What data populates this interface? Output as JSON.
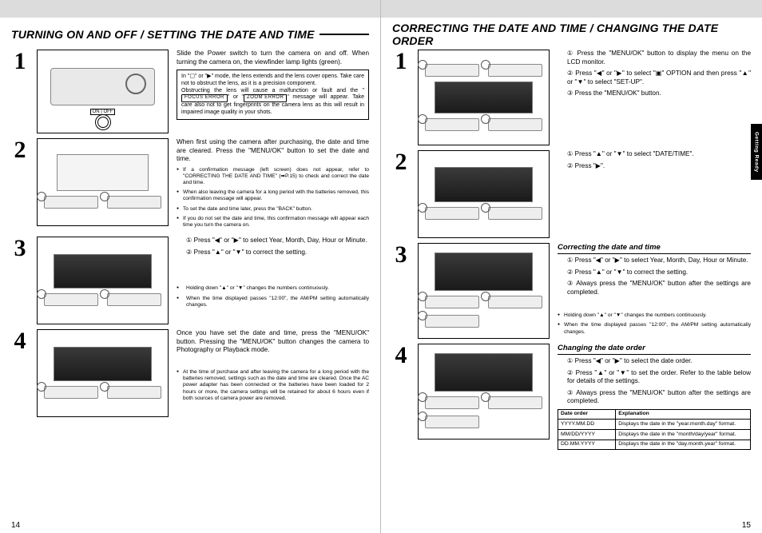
{
  "left": {
    "title": "TURNING ON AND OFF / SETTING THE DATE AND TIME",
    "page_num": "14",
    "steps": {
      "s1": {
        "num": "1",
        "body": "Slide the Power switch to turn the camera on and off. When turning the camera on, the viewfinder lamp lights (green).",
        "note": "In \"▢\" or \"▶\" mode, the lens extends and the lens cover opens. Take care not to obstruct the lens, as it is a precision component.\nObstructing the lens will cause a malfunction or fault and the \"[FOCUS ERROR]\" or \"[ZOOM ERROR]\" message will appear. Take care also not to get fingerprints on the camera lens as this will result in impaired image quality in your shots.",
        "err1": "FOCUS ERROR",
        "err2": "ZOOM ERROR"
      },
      "s2": {
        "num": "2",
        "body": "When first using the camera after purchasing, the date and time are cleared. Press the \"MENU/OK\" button to set the date and time.",
        "tiny1": "If a confirmation message (left screen) does not appear, refer to \"CORRECTING THE DATE AND TIME\" (➡P.15) to check and correct the date and time.",
        "tiny2": "When also leaving the camera for a long period with the batteries removed, this confirmation message will appear.",
        "tiny3": "To set the date and time later, press the \"BACK\" button.",
        "tiny4": "If you do not set the date and time, this confirmation message will appear each time you turn the camera on."
      },
      "s3": {
        "num": "3",
        "l1": "① Press \"◀\" or \"▶\" to select Year, Month, Day, Hour or Minute.",
        "l2": "② Press \"▲\" or \"▼\" to correct the setting.",
        "tiny1": "Holding down \"▲\" or \"▼\" changes the numbers continuously.",
        "tiny2": "When the time displayed passes \"12:00\", the AM/PM setting automatically changes."
      },
      "s4": {
        "num": "4",
        "body": "Once you have set the date and time, press the \"MENU/OK\" button. Pressing the \"MENU/OK\" button changes the camera to Photography or Playback mode.",
        "tiny1": "At the time of purchase and after leaving the camera for a long period with the batteries removed, settings such as the date and time are cleared. Once the AC power adapter has been connected or the batteries have been loaded for 2 hours or more, the camera settings will be retained for about 6 hours even if both sources of camera power are removed."
      }
    }
  },
  "right": {
    "title": "CORRECTING THE DATE AND TIME / CHANGING THE DATE ORDER",
    "page_num": "15",
    "side_tab": "Getting Ready",
    "steps": {
      "s1": {
        "num": "1",
        "l1": "① Press the \"MENU/OK\" button to display the menu on the LCD monitor.",
        "l2": "② Press \"◀\" or \"▶\" to select \"▣\" OPTION and then press \"▲\" or \"▼\" to select \"SET-UP\".",
        "l3": "③ Press the \"MENU/OK\" button."
      },
      "s2": {
        "num": "2",
        "l1": "① Press \"▲\" or \"▼\" to select \"DATE/TIME\".",
        "l2": "② Press \"▶\"."
      },
      "s3": {
        "num": "3",
        "head": "Correcting the date and time",
        "l1": "① Press \"◀\" or \"▶\" to select Year, Month, Day, Hour or Minute.",
        "l2": "② Press \"▲\" or \"▼\" to correct the setting.",
        "l3": "③ Always press the \"MENU/OK\" button after the settings are completed.",
        "tiny1": "Holding down \"▲\" or \"▼\" changes the numbers continuously.",
        "tiny2": "When the time displayed passes \"12:00\", the AM/PM setting automatically changes."
      },
      "s4": {
        "num": "4",
        "head": "Changing the date order",
        "l1": "① Press \"◀\" or \"▶\" to select the date order.",
        "l2": "② Press \"▲\" or \"▼\" to set the order. Refer to the table below for details of the settings.",
        "l3": "③ Always press the \"MENU/OK\" button after the settings are completed.",
        "table": {
          "h1": "Date order",
          "h2": "Explanation",
          "r1c1": "YYYY.MM.DD",
          "r1c2": "Displays the date in the \"year.month.day\" format.",
          "r2c1": "MM/DD/YYYY",
          "r2c2": "Displays the date in the \"month/day/year\" format.",
          "r3c1": "DD.MM.YYYY",
          "r3c2": "Displays the date in the \"day.month.year\" format."
        }
      }
    }
  }
}
